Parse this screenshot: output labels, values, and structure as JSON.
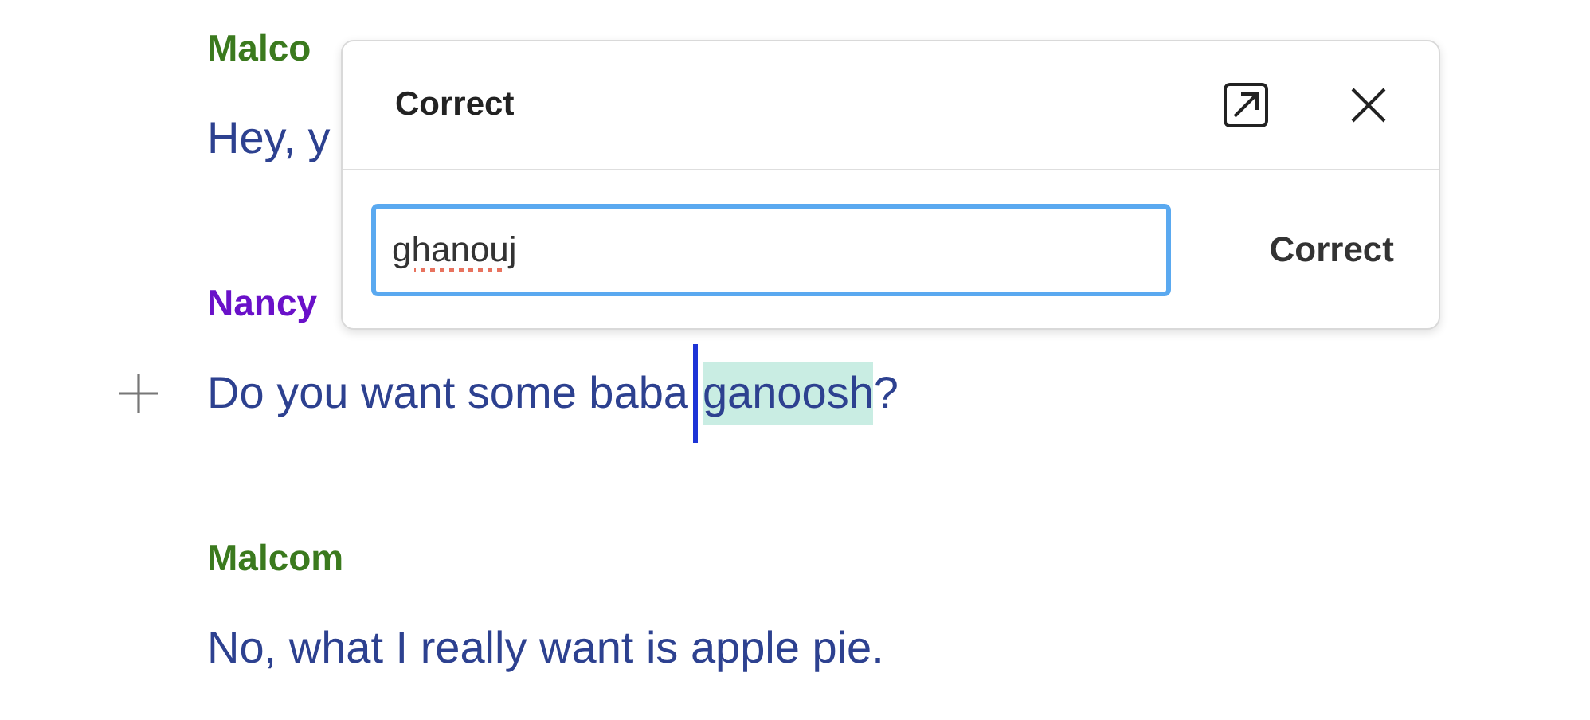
{
  "transcript": [
    {
      "speaker": "Malco",
      "color": "#3b7a1e",
      "add_button": false,
      "segments": [
        {
          "text": "Hey, y",
          "highlighted": false,
          "cursor_before": false
        }
      ]
    },
    {
      "speaker": "Nancy",
      "color": "#6a11c9",
      "add_button": true,
      "segments": [
        {
          "text": "Do you want some baba",
          "highlighted": false,
          "cursor_before": false
        },
        {
          "text": "ganoosh",
          "highlighted": true,
          "cursor_before": true
        },
        {
          "text": "?",
          "highlighted": false,
          "cursor_before": false
        }
      ]
    },
    {
      "speaker": "Malcom",
      "color": "#3b7a1e",
      "add_button": false,
      "segments": [
        {
          "text": "No, what I really want is apple pie.",
          "highlighted": false,
          "cursor_before": false
        }
      ]
    }
  ],
  "correct_popup": {
    "title": "Correct",
    "input": {
      "value": "ghanouj",
      "misspelled": true
    },
    "button": "Correct"
  }
}
